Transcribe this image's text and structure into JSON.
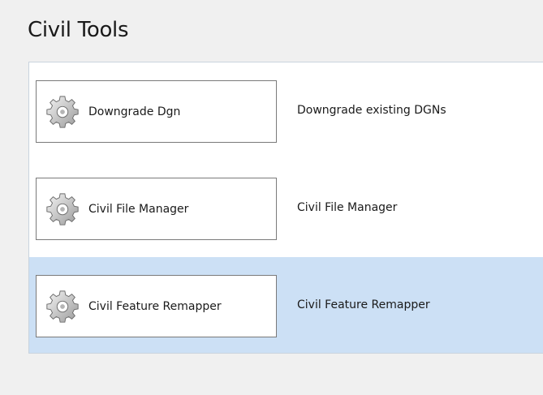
{
  "page": {
    "title": "Civil Tools"
  },
  "tools": [
    {
      "label": "Downgrade Dgn",
      "description": "Downgrade existing DGNs",
      "icon": "gear-icon",
      "selected": false
    },
    {
      "label": "Civil File Manager",
      "description": "Civil File Manager",
      "icon": "gear-icon",
      "selected": false
    },
    {
      "label": "Civil Feature Remapper",
      "description": "Civil Feature Remapper",
      "icon": "gear-icon",
      "selected": true
    }
  ],
  "colors": {
    "selected_row": "#cce0f5",
    "background": "#f0f0f0"
  }
}
